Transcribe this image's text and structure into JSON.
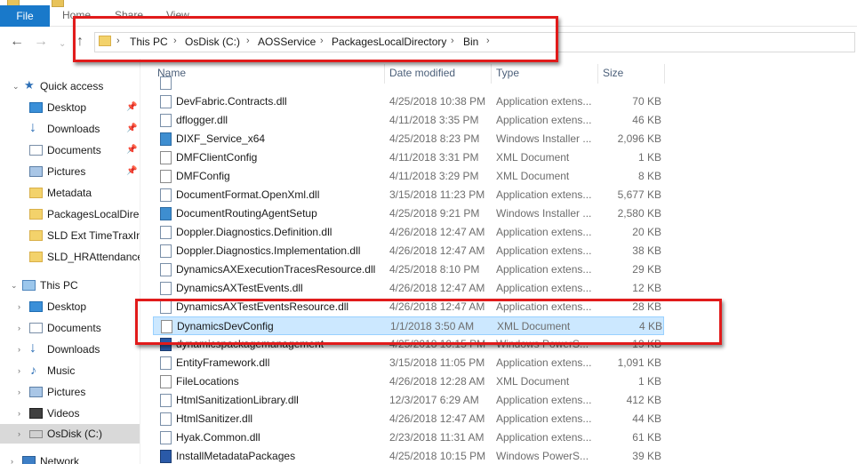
{
  "ribbon": {
    "file_label": "File",
    "tabs": [
      "Home",
      "Share",
      "View"
    ]
  },
  "breadcrumb": [
    "This PC",
    "OsDisk (C:)",
    "AOSService",
    "PackagesLocalDirectory",
    "Bin"
  ],
  "nav_pane": {
    "quick_access_label": "Quick access",
    "quick_access_items": [
      {
        "label": "Desktop",
        "icon": "desktop-icon",
        "pinned": true
      },
      {
        "label": "Downloads",
        "icon": "download-icon",
        "pinned": true
      },
      {
        "label": "Documents",
        "icon": "documents-icon",
        "pinned": true
      },
      {
        "label": "Pictures",
        "icon": "pictures-icon",
        "pinned": true
      },
      {
        "label": "Metadata",
        "icon": "folder-icon",
        "pinned": false
      },
      {
        "label": "PackagesLocalDirec",
        "icon": "folder-icon",
        "pinned": false
      },
      {
        "label": "SLD Ext TimeTraxInt",
        "icon": "folder-icon",
        "pinned": false
      },
      {
        "label": "SLD_HRAttendance",
        "icon": "folder-icon",
        "pinned": false
      }
    ],
    "this_pc_label": "This PC",
    "this_pc_items": [
      {
        "label": "Desktop",
        "icon": "desktop-icon"
      },
      {
        "label": "Documents",
        "icon": "documents-icon"
      },
      {
        "label": "Downloads",
        "icon": "download-icon"
      },
      {
        "label": "Music",
        "icon": "music-icon"
      },
      {
        "label": "Pictures",
        "icon": "pictures-icon"
      },
      {
        "label": "Videos",
        "icon": "videos-icon"
      },
      {
        "label": "OsDisk (C:)",
        "icon": "drive-icon",
        "selected": true
      }
    ],
    "network_label": "Network"
  },
  "columns": {
    "name": "Name",
    "date": "Date modified",
    "type": "Type",
    "size": "Size"
  },
  "files": [
    {
      "name": "",
      "date": "",
      "type": "",
      "size": "",
      "icon": "dll"
    },
    {
      "name": "DevFabric.Contracts.dll",
      "date": "4/25/2018 10:38 PM",
      "type": "Application extens...",
      "size": "70 KB",
      "icon": "dll"
    },
    {
      "name": "dflogger.dll",
      "date": "4/11/2018 3:35 PM",
      "type": "Application extens...",
      "size": "46 KB",
      "icon": "dll"
    },
    {
      "name": "DIXF_Service_x64",
      "date": "4/25/2018 8:23 PM",
      "type": "Windows Installer ...",
      "size": "2,096 KB",
      "icon": "msi"
    },
    {
      "name": "DMFClientConfig",
      "date": "4/11/2018 3:31 PM",
      "type": "XML Document",
      "size": "1 KB",
      "icon": "xml"
    },
    {
      "name": "DMFConfig",
      "date": "4/11/2018 3:29 PM",
      "type": "XML Document",
      "size": "8 KB",
      "icon": "xml"
    },
    {
      "name": "DocumentFormat.OpenXml.dll",
      "date": "3/15/2018 11:23 PM",
      "type": "Application extens...",
      "size": "5,677 KB",
      "icon": "dll"
    },
    {
      "name": "DocumentRoutingAgentSetup",
      "date": "4/25/2018 9:21 PM",
      "type": "Windows Installer ...",
      "size": "2,580 KB",
      "icon": "msi"
    },
    {
      "name": "Doppler.Diagnostics.Definition.dll",
      "date": "4/26/2018 12:47 AM",
      "type": "Application extens...",
      "size": "20 KB",
      "icon": "dll"
    },
    {
      "name": "Doppler.Diagnostics.Implementation.dll",
      "date": "4/26/2018 12:47 AM",
      "type": "Application extens...",
      "size": "38 KB",
      "icon": "dll"
    },
    {
      "name": "DynamicsAXExecutionTracesResource.dll",
      "date": "4/25/2018 8:10 PM",
      "type": "Application extens...",
      "size": "29 KB",
      "icon": "dll"
    },
    {
      "name": "DynamicsAXTestEvents.dll",
      "date": "4/26/2018 12:47 AM",
      "type": "Application extens...",
      "size": "12 KB",
      "icon": "dll"
    },
    {
      "name": "DynamicsAXTestEventsResource.dll",
      "date": "4/26/2018 12:47 AM",
      "type": "Application extens...",
      "size": "28 KB",
      "icon": "dll"
    },
    {
      "name": "DynamicsDevConfig",
      "date": "1/1/2018 3:50 AM",
      "type": "XML Document",
      "size": "4 KB",
      "icon": "xml",
      "selected": true
    },
    {
      "name": "dynamicspackagemanagement",
      "date": "4/25/2018 10:15 PM",
      "type": "Windows PowerS...",
      "size": "19 KB",
      "icon": "ps"
    },
    {
      "name": "EntityFramework.dll",
      "date": "3/15/2018 11:05 PM",
      "type": "Application extens...",
      "size": "1,091 KB",
      "icon": "dll"
    },
    {
      "name": "FileLocations",
      "date": "4/26/2018 12:28 AM",
      "type": "XML Document",
      "size": "1 KB",
      "icon": "xml"
    },
    {
      "name": "HtmlSanitizationLibrary.dll",
      "date": "12/3/2017 6:29 AM",
      "type": "Application extens...",
      "size": "412 KB",
      "icon": "dll"
    },
    {
      "name": "HtmlSanitizer.dll",
      "date": "4/26/2018 12:47 AM",
      "type": "Application extens...",
      "size": "44 KB",
      "icon": "dll"
    },
    {
      "name": "Hyak.Common.dll",
      "date": "2/23/2018 11:31 AM",
      "type": "Application extens...",
      "size": "61 KB",
      "icon": "dll"
    },
    {
      "name": "InstallMetadataPackages",
      "date": "4/25/2018 10:15 PM",
      "type": "Windows PowerS...",
      "size": "39 KB",
      "icon": "ps"
    }
  ]
}
